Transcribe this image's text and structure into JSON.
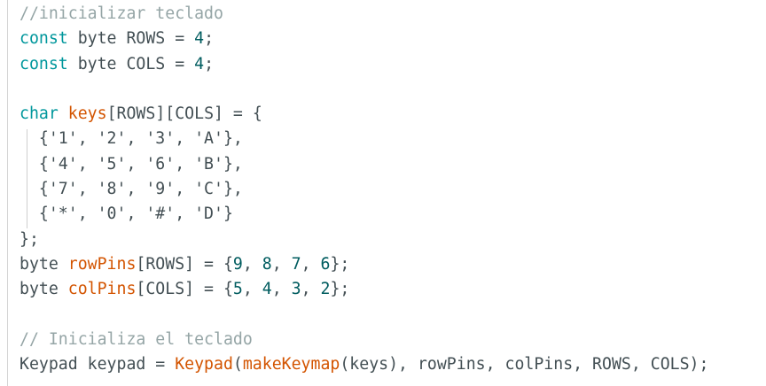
{
  "editor": {
    "lines": [
      [
        {
          "t": "//inicializar teclado",
          "c": "comment"
        }
      ],
      [
        {
          "t": "const",
          "c": "keyword"
        },
        {
          "t": " byte ROWS = ",
          "c": "plain"
        },
        {
          "t": "4",
          "c": "number"
        },
        {
          "t": ";",
          "c": "plain"
        }
      ],
      [
        {
          "t": "const",
          "c": "keyword"
        },
        {
          "t": " byte COLS = ",
          "c": "plain"
        },
        {
          "t": "4",
          "c": "number"
        },
        {
          "t": ";",
          "c": "plain"
        }
      ],
      [],
      [
        {
          "t": "char",
          "c": "keyword"
        },
        {
          "t": " ",
          "c": "plain"
        },
        {
          "t": "keys",
          "c": "func"
        },
        {
          "t": "[ROWS][COLS] = {",
          "c": "plain"
        }
      ],
      [
        {
          "t": "  {'1', '2', '3', 'A'},",
          "c": "plain"
        }
      ],
      [
        {
          "t": "  {'4', '5', '6', 'B'},",
          "c": "plain"
        }
      ],
      [
        {
          "t": "  {'7', '8', '9', 'C'},",
          "c": "plain"
        }
      ],
      [
        {
          "t": "  {'*', '0', '#', 'D'}",
          "c": "plain"
        }
      ],
      [
        {
          "t": "};",
          "c": "plain"
        }
      ],
      [
        {
          "t": "byte ",
          "c": "plain"
        },
        {
          "t": "rowPins",
          "c": "func"
        },
        {
          "t": "[ROWS] = {",
          "c": "plain"
        },
        {
          "t": "9",
          "c": "number"
        },
        {
          "t": ", ",
          "c": "plain"
        },
        {
          "t": "8",
          "c": "number"
        },
        {
          "t": ", ",
          "c": "plain"
        },
        {
          "t": "7",
          "c": "number"
        },
        {
          "t": ", ",
          "c": "plain"
        },
        {
          "t": "6",
          "c": "number"
        },
        {
          "t": "};",
          "c": "plain"
        }
      ],
      [
        {
          "t": "byte ",
          "c": "plain"
        },
        {
          "t": "colPins",
          "c": "func"
        },
        {
          "t": "[COLS] = {",
          "c": "plain"
        },
        {
          "t": "5",
          "c": "number"
        },
        {
          "t": ", ",
          "c": "plain"
        },
        {
          "t": "4",
          "c": "number"
        },
        {
          "t": ", ",
          "c": "plain"
        },
        {
          "t": "3",
          "c": "number"
        },
        {
          "t": ", ",
          "c": "plain"
        },
        {
          "t": "2",
          "c": "number"
        },
        {
          "t": "};",
          "c": "plain"
        }
      ],
      [],
      [
        {
          "t": "// Inicializa el teclado",
          "c": "comment"
        }
      ],
      [
        {
          "t": "Keypad keypad = ",
          "c": "plain"
        },
        {
          "t": "Keypad",
          "c": "func"
        },
        {
          "t": "(",
          "c": "plain"
        },
        {
          "t": "makeKeymap",
          "c": "func"
        },
        {
          "t": "(keys), rowPins, colPins, ROWS, COLS);",
          "c": "plain"
        }
      ]
    ]
  },
  "colors": {
    "comment": "#95a5a6",
    "keyword": "#00979c",
    "plain": "#434f54",
    "function": "#d35400",
    "number": "#005c5f",
    "background": "#ffffff"
  }
}
